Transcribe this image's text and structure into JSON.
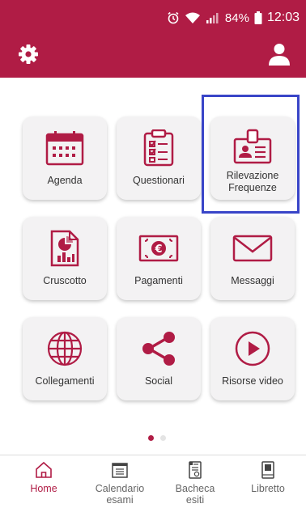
{
  "colors": {
    "brand": "#b01c45",
    "highlight": "#3945c8",
    "tile_bg": "#f3f2f3"
  },
  "status_bar": {
    "alarm_icon": "alarm-icon",
    "wifi_icon": "wifi-icon",
    "signal_icon": "signal-icon",
    "battery": "84%",
    "time": "12:03"
  },
  "app_bar": {
    "settings_icon": "gear-icon",
    "profile_icon": "user-icon"
  },
  "grid": {
    "tiles": [
      {
        "label": "Agenda",
        "icon": "calendar-icon"
      },
      {
        "label": "Questionari",
        "icon": "clipboard-checklist-icon"
      },
      {
        "label_line1": "Rilevazione",
        "label_line2": "Frequenze",
        "icon": "badge-id-icon"
      },
      {
        "label": "Cruscotto",
        "icon": "report-chart-icon"
      },
      {
        "label": "Pagamenti",
        "icon": "euro-banknote-icon"
      },
      {
        "label": "Messaggi",
        "icon": "envelope-icon"
      },
      {
        "label": "Collegamenti",
        "icon": "globe-icon"
      },
      {
        "label": "Social",
        "icon": "share-icon"
      },
      {
        "label": "Risorse video",
        "icon": "play-circle-icon"
      }
    ]
  },
  "pager": {
    "active_page": 1,
    "page_count": 2
  },
  "bottom_nav": {
    "items": [
      {
        "label": "Home",
        "icon": "home-icon",
        "active": true
      },
      {
        "label_line1": "Calendario",
        "label_line2": "esami",
        "icon": "calendar-list-icon",
        "active": false
      },
      {
        "label_line1": "Bacheca",
        "label_line2": "esiti",
        "icon": "results-board-icon",
        "active": false
      },
      {
        "label": "Libretto",
        "icon": "booklet-icon",
        "active": false
      }
    ]
  }
}
